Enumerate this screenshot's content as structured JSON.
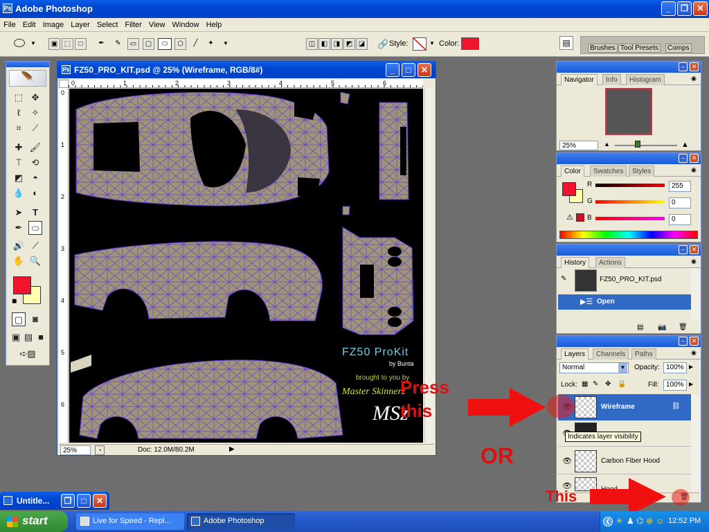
{
  "app": {
    "title": "Adobe Photoshop"
  },
  "menu": [
    "File",
    "Edit",
    "Image",
    "Layer",
    "Select",
    "Filter",
    "View",
    "Window",
    "Help"
  ],
  "options_bar": {
    "style_label": "Style:",
    "color_label": "Color:",
    "color_swatch": "#f0142d"
  },
  "palette_well": [
    "Brushes",
    "Tool Presets",
    "Comps"
  ],
  "document": {
    "title": "FZ50_PRO_KIT.psd @ 25% (Wireframe, RGB/8#)",
    "zoom": "25%",
    "doc_size": "Doc: 12.0M/80.2M",
    "ruler_h": [
      "0",
      "1",
      "2",
      "3",
      "4",
      "5",
      "6"
    ],
    "ruler_v": [
      "0",
      "1",
      "2",
      "3",
      "4",
      "5",
      "6"
    ],
    "overlay": {
      "title": "FZ50  ProKit",
      "subtitle": "by Bunta",
      "brought": "brought to you by",
      "brand": "Master Skinnerz",
      "logo_text": "MSz"
    }
  },
  "navigator": {
    "tabs": [
      "Navigator",
      "Info",
      "Histogram"
    ],
    "zoom": "25%"
  },
  "color_panel": {
    "tabs": [
      "Color",
      "Swatches",
      "Styles"
    ],
    "labels": [
      "R",
      "G",
      "B"
    ],
    "values": [
      "255",
      "0",
      "0"
    ],
    "fg": "#f0142d",
    "bg": "#ffffb0"
  },
  "history": {
    "tabs": [
      "History",
      "Actions"
    ],
    "snapshot": "FZ50_PRO_KIT.psd",
    "steps": [
      "Open"
    ]
  },
  "layers": {
    "tabs": [
      "Layers",
      "Channels",
      "Paths"
    ],
    "blend": "Normal",
    "opacity_label": "Opacity:",
    "opacity": "100%",
    "lock_label": "Lock:",
    "fill_label": "Fill:",
    "fill": "100%",
    "items": [
      "Wireframe",
      "",
      "Carbon Fiber Hood",
      "Hood"
    ],
    "tooltip": "Indicates layer visibility"
  },
  "annotations": {
    "press_this": [
      "Press",
      "this"
    ],
    "or": "OR",
    "this": "This"
  },
  "minimized_window": "Untitle...",
  "taskbar": {
    "start": "start",
    "tasks": [
      "Live for Speed - Repl...",
      "Adobe Photoshop"
    ],
    "clock": "12:52 PM"
  }
}
